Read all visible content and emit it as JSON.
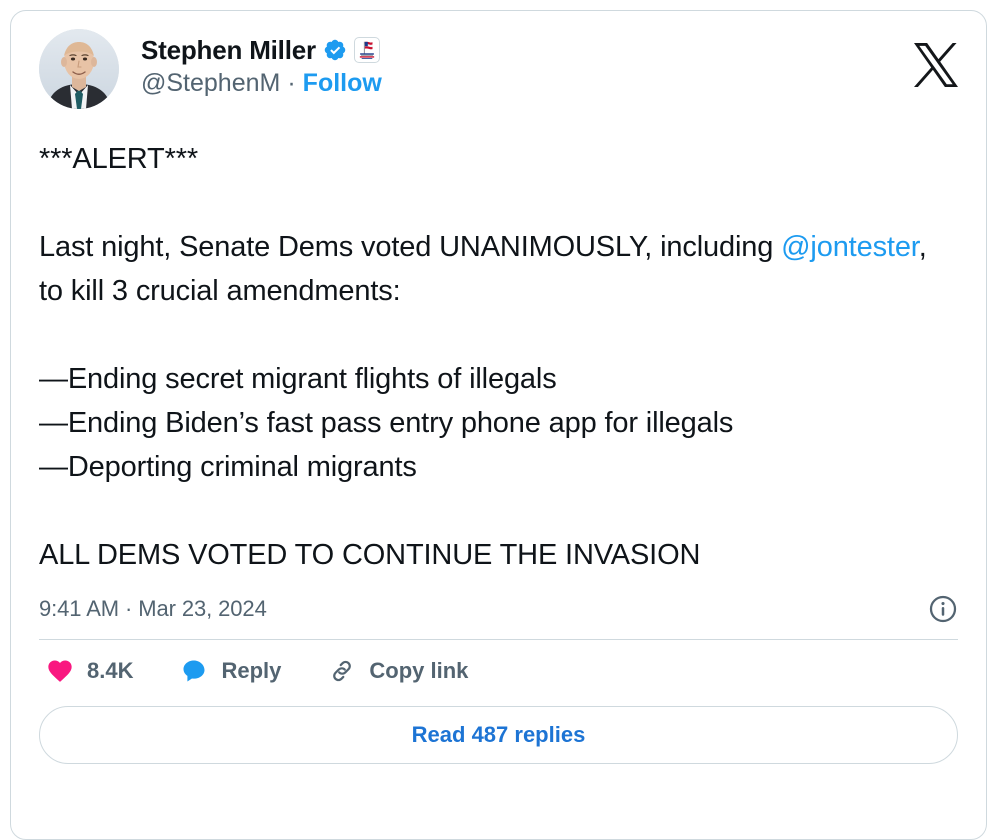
{
  "card": {
    "platform": "X",
    "brand_color": "#1d9bf0"
  },
  "author": {
    "display_name": "Stephen Miller",
    "handle": "@StephenM",
    "verified_badge": "verified-check-icon",
    "affiliate_badge": "america-first-badge-icon",
    "avatar_alt": "Stephen Miller profile photo",
    "follow_label": "Follow",
    "separator": "·"
  },
  "tweet": {
    "line_alert": "***ALERT***",
    "line_blank_1": "",
    "paragraph_prefix": "Last night, Senate Dems voted UNANIMOUSLY, including ",
    "mention": "@jontester",
    "paragraph_suffix": ", to kill 3 crucial amendments:",
    "line_blank_2": "",
    "bullet_1": "—Ending secret migrant flights of illegals",
    "bullet_2": "—Ending Biden’s fast pass entry phone app for illegals",
    "bullet_3": "—Deporting criminal migrants",
    "line_blank_3": "",
    "closing": "ALL DEMS VOTED TO CONTINUE THE INVASION"
  },
  "meta": {
    "timestamp": "9:41 AM · Mar 23, 2024",
    "info_icon": "info-circle-icon"
  },
  "actions": {
    "like": {
      "icon": "heart-icon",
      "color": "#f91880",
      "count": "8.4K"
    },
    "reply": {
      "icon": "speech-bubble-icon",
      "color": "#1d9bf0",
      "label": "Reply"
    },
    "copy_link": {
      "icon": "link-chain-icon",
      "color": "#536471",
      "label": "Copy link"
    }
  },
  "footer": {
    "read_replies_label": "Read 487 replies"
  }
}
